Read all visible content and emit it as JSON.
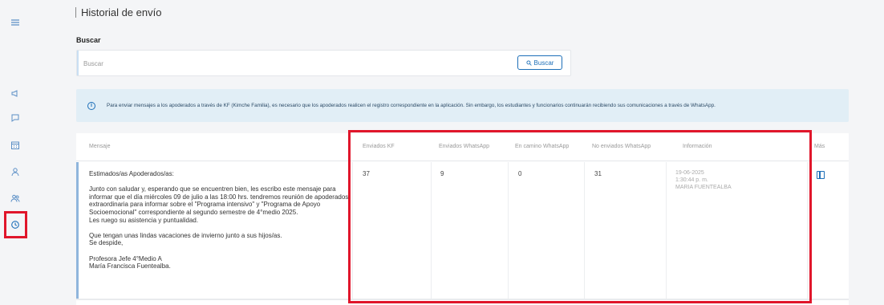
{
  "sidebar": {
    "icons": [
      {
        "name": "menu-icon"
      },
      {
        "name": "megaphone-icon"
      },
      {
        "name": "chat-icon"
      },
      {
        "name": "calendar-icon"
      },
      {
        "name": "person-icon"
      },
      {
        "name": "group-icon"
      },
      {
        "name": "history-icon",
        "active": true
      }
    ]
  },
  "page": {
    "title": "Historial de envío"
  },
  "search": {
    "label": "Buscar",
    "placeholder": "Buscar",
    "value": "",
    "button_label": "Buscar"
  },
  "banner": {
    "text": "Para enviar mensajes a los apoderados a través de KF (Kimche Familia), es necesario que los apoderados realicen el registro correspondiente en la aplicación. Sin embargo, los estudiantes y funcionarios continuarán recibiendo sus comunicaciones a través de WhatsApp."
  },
  "table": {
    "headers": {
      "message": "Mensaje",
      "sent_kf": "Enviados KF",
      "sent_whatsapp": "Enviados WhatsApp",
      "in_transit_whatsapp": "En camino WhatsApp",
      "not_sent_whatsapp": "No enviados WhatsApp",
      "info": "Información",
      "more": "Más"
    },
    "rows": [
      {
        "message": "Estimados/as Apoderados/as:\n\nJunto con saludar y, esperando que se encuentren bien, les escribo este mensaje para informar que el día miércoles 09 de julio a las 18:00 hrs. tendremos reunión de apoderados extraordinaria para informar sobre el \"Programa intensivo\" y \"Programa de Apoyo Socioemocional\" correspondiente al segundo semestre de 4°medio 2025.\nLes ruego su asistencia y puntualidad.\n\nQue tengan unas lindas vacaciones de invierno junto a sus hijos/as.\nSe despide,\n\nProfesora Jefe 4°Medio A\nMaría Francisca Fuentealba.",
        "sent_kf": "37",
        "sent_whatsapp": "9",
        "in_transit_whatsapp": "0",
        "not_sent_whatsapp": "31",
        "info_date": "19-06-2025",
        "info_time": "1:30:44 p. m.",
        "info_author": "MARIA FUENTEALBA"
      }
    ]
  },
  "colors": {
    "accent": "#1d6fb8",
    "highlight": "#e0162b",
    "banner_bg": "#e1eef6"
  }
}
